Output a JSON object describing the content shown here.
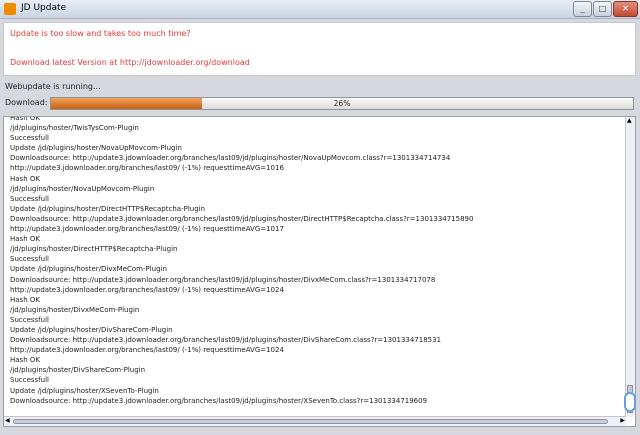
{
  "window": {
    "title": "JD Update",
    "minimize": "_",
    "maximize": "□",
    "close": "✕"
  },
  "banner": {
    "line1": "Update is too slow and takes too much time?",
    "line2": "Download latest Version at http://jdownloader.org/download"
  },
  "status_text": "Webupdate is running...",
  "download": {
    "label": "Download:",
    "progress_percent": 26,
    "progress_text": "26%"
  },
  "colors": {
    "banner_text": "#e23a3a",
    "progress_fill": "#d8731f"
  },
  "log_lines": [
    "Hash OK",
    "/jd/plugins/hoster/TwisTysCom-Plugin",
    "Successfull",
    "Update /jd/plugins/hoster/NovaUpMovcom-Plugin",
    "Downloadsource: http://update3.jdownloader.org/branches/last09/jd/plugins/hoster/NovaUpMovcom.class?r=1301334714734",
    "http://update3.jdownloader.org/branches/last09/ (-1%) requesttimeAVG=1016",
    "Hash OK",
    "/jd/plugins/hoster/NovaUpMovcom-Plugin",
    "Successfull",
    "Update /jd/plugins/hoster/DirectHTTP$Recaptcha-Plugin",
    "Downloadsource: http://update3.jdownloader.org/branches/last09/jd/plugins/hoster/DirectHTTP$Recaptcha.class?r=1301334715890",
    "http://update3.jdownloader.org/branches/last09/ (-1%) requesttimeAVG=1017",
    "Hash OK",
    "/jd/plugins/hoster/DirectHTTP$Recaptcha-Plugin",
    "Successfull",
    "Update /jd/plugins/hoster/DivxMeCom-Plugin",
    "Downloadsource: http://update3.jdownloader.org/branches/last09/jd/plugins/hoster/DivxMeCom.class?r=1301334717078",
    "http://update3.jdownloader.org/branches/last09/ (-1%) requesttimeAVG=1024",
    "Hash OK",
    "/jd/plugins/hoster/DivxMeCom-Plugin",
    "Successfull",
    "Update /jd/plugins/hoster/DivShareCom-Plugin",
    "Downloadsource: http://update3.jdownloader.org/branches/last09/jd/plugins/hoster/DivShareCom.class?r=1301334718531",
    "http://update3.jdownloader.org/branches/last09/ (-1%) requesttimeAVG=1024",
    "Hash OK",
    "/jd/plugins/hoster/DivShareCom-Plugin",
    "Successfull",
    "Update /jd/plugins/hoster/XSevenTo-Plugin",
    "Downloadsource: http://update3.jdownloader.org/branches/last09/jd/plugins/hoster/XSevenTo.class?r=1301334719609"
  ]
}
